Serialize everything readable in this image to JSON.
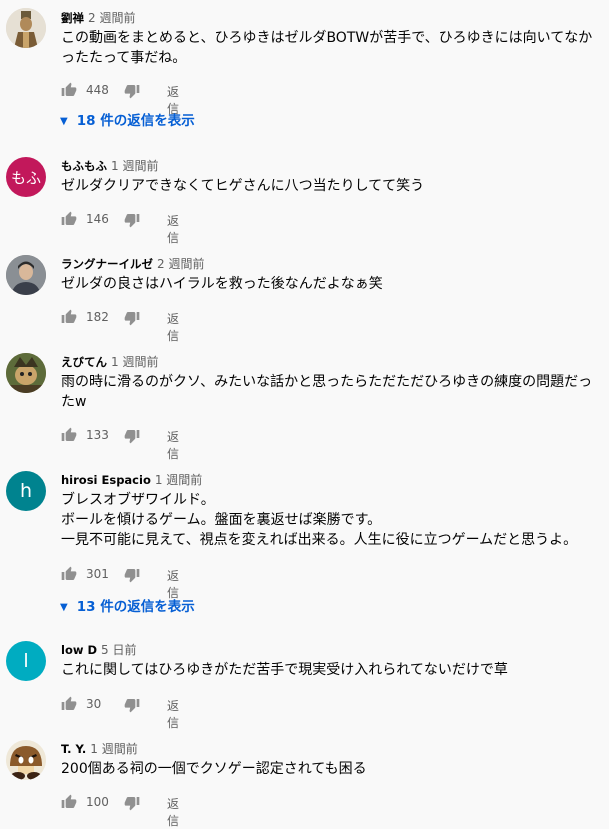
{
  "like_color": "#909090",
  "link_color": "#065fd4",
  "comments": [
    {
      "author": "劉禅",
      "time": "2 週間前",
      "text": "この動画をまとめると、ひろゆきはゼルダBOTWが苦手で、ひろゆきには向いてなか\nったたって事だね。",
      "likes": "448",
      "reply": "返信",
      "replies": "18 件の返信を表示",
      "avatar_icon": "statue-avatar"
    },
    {
      "author": "もふもふ",
      "time": "1 週間前",
      "text": "ゼルダクリアできなくてヒゲさんに八つ当たりしてて笑う",
      "likes": "146",
      "reply": "返信",
      "avatar_text": "もふ",
      "avatar_color": "#c2185b"
    },
    {
      "author": "ラングナーイルゼ",
      "time": "2 週間前",
      "text": "ゼルダの良さはハイラルを救った後なんだよなぁ笑",
      "likes": "182",
      "reply": "返信",
      "avatar_icon": "person-photo-avatar"
    },
    {
      "author": "えびてん",
      "time": "1 週間前",
      "text": "雨の時に滑るのがクソ、みたいな話かと思ったらただただひろゆきの練度の問題だっ\nたw",
      "likes": "133",
      "reply": "返信",
      "avatar_icon": "character-avatar"
    },
    {
      "author": "hirosi Espacio",
      "time": "1 週間前",
      "text": "ブレスオブザワイルド。\nボールを傾けるゲーム。盤面を裏返せば楽勝です。\n一見不可能に見えて、視点を変えれば出来る。人生に役に立つゲームだと思うよ。",
      "likes": "301",
      "reply": "返信",
      "replies": "13 件の返信を表示",
      "avatar_text": "h",
      "avatar_color": "#00838f"
    },
    {
      "author": "low D",
      "time": "5 日前",
      "text": "これに関してはひろゆきがただ苦手で現実受け入れられてないだけで草",
      "likes": "30",
      "reply": "返信",
      "avatar_text": "l",
      "avatar_color": "#00acc1"
    },
    {
      "author": "T. Y.",
      "time": "1 週間前",
      "text": "200個ある祠の一個でクソゲー認定されても困る",
      "likes": "100",
      "reply": "返信",
      "avatar_icon": "goomba-avatar"
    }
  ]
}
